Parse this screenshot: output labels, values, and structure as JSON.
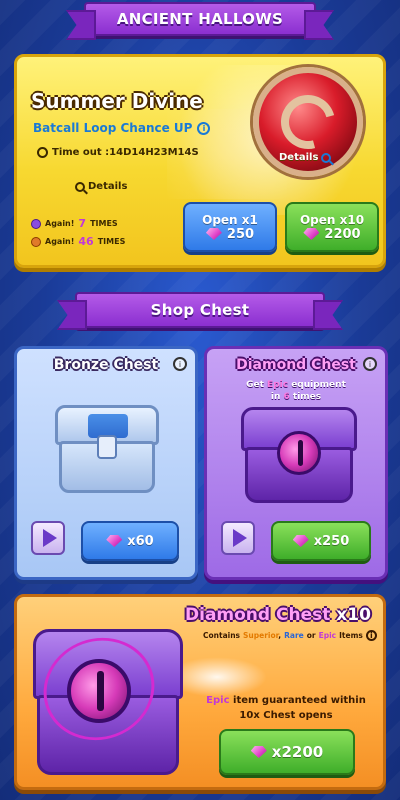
{
  "event_banner": {
    "title": "ANCIENT HALLOWS"
  },
  "event": {
    "name": "Summer Divine",
    "subtitle": "Batcall Loop Chance UP",
    "timeout": "Time out :14D14H23M14S",
    "details_left": "Details",
    "details_right": "Details",
    "again_rows": [
      {
        "label": "Again!",
        "count": "7",
        "unit": "TIMES",
        "icon": "purple-coin-icon",
        "color": "#8a4de0"
      },
      {
        "label": "Again!",
        "count": "46",
        "unit": "TIMES",
        "icon": "orange-coin-icon",
        "color": "#e07a2a"
      }
    ],
    "open1": {
      "label": "Open x1",
      "cost": "250"
    },
    "open10": {
      "label": "Open x10",
      "cost": "2200"
    }
  },
  "shop_banner": {
    "title": "Shop Chest"
  },
  "bronze": {
    "title": "Bronze Chest",
    "cost": "x60"
  },
  "diamond": {
    "title": "Diamond Chest",
    "desc_pre": "Get ",
    "desc_hl": "Epic",
    "desc_post": " equipment",
    "desc_line2_pre": "in ",
    "desc_line2_hl": "6",
    "desc_line2_post": " times",
    "cost": "x250"
  },
  "big": {
    "title": "Diamond Chest",
    "multiplier": "x10",
    "contains_pre": "Contains",
    "contains_sup": "Superior",
    "contains_sep1": ",",
    "contains_rare": "Rare",
    "contains_or": "or",
    "contains_epic": "Epic",
    "contains_post": "Items",
    "desc_epic": "Epic",
    "desc_rest": " item guaranteed within",
    "desc_line2": "10x Chest opens",
    "cost": "x2200"
  },
  "colors": {
    "accent_purple": "#8b2fd0",
    "gem_pink": "#e040c8",
    "green_button": "#3fae2a",
    "blue_button": "#2f7ae8"
  }
}
